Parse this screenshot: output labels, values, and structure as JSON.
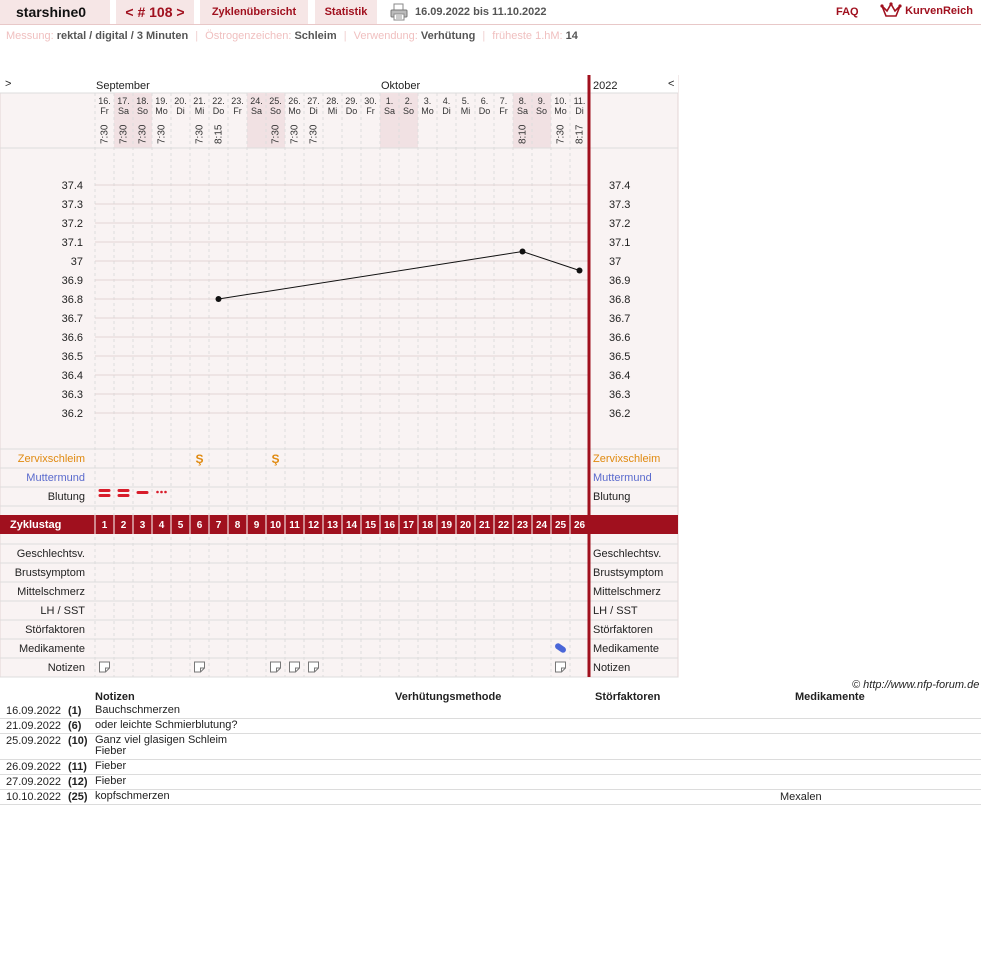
{
  "header": {
    "username": "starshine0",
    "cycle": "< # 108 >",
    "overview_label": "Zyklenübersicht",
    "statistics_label": "Statistik",
    "date_range": "16.09.2022 bis 11.10.2022",
    "faq_label": "FAQ",
    "logo_text": "KurvenReich"
  },
  "info": {
    "messung_label": "Messung:",
    "messung_value": "rektal / digital / 3 Minuten",
    "oestrogen_label": "Östrogenzeichen:",
    "oestrogen_value": "Schleim",
    "verwendung_label": "Verwendung:",
    "verwendung_value": "Verhütung",
    "hm_label": "früheste 1.hM:",
    "hm_value": "14"
  },
  "chart_data": {
    "type": "line",
    "title": "",
    "xlabel": "",
    "ylabel": "",
    "ylim": [
      36.2,
      37.4
    ],
    "y_ticks": [
      "37.4",
      "37.3",
      "37.2",
      "37.1",
      "37",
      "36.9",
      "36.8",
      "36.7",
      "36.6",
      "36.5",
      "36.4",
      "36.3",
      "36.2"
    ],
    "months": [
      {
        "label": "September",
        "start_index": 0
      },
      {
        "label": "Oktober",
        "start_index": 15
      }
    ],
    "year": "2022",
    "nav_prev": ">",
    "nav_next": "<",
    "dates": [
      "16.",
      "17.",
      "18.",
      "19.",
      "20.",
      "21.",
      "22.",
      "23.",
      "24.",
      "25.",
      "26.",
      "27.",
      "28.",
      "29.",
      "30.",
      "1.",
      "2.",
      "3.",
      "4.",
      "5.",
      "6.",
      "7.",
      "8.",
      "9.",
      "10.",
      "11."
    ],
    "weekdays": [
      "Fr",
      "Sa",
      "So",
      "Mo",
      "Di",
      "Mi",
      "Do",
      "Fr",
      "Sa",
      "So",
      "Mo",
      "Di",
      "Mi",
      "Do",
      "Fr",
      "Sa",
      "So",
      "Mo",
      "Di",
      "Mi",
      "Do",
      "Fr",
      "Sa",
      "So",
      "Mo",
      "Di"
    ],
    "weekend": [
      false,
      true,
      true,
      false,
      false,
      false,
      false,
      false,
      true,
      true,
      false,
      false,
      false,
      false,
      false,
      true,
      true,
      false,
      false,
      false,
      false,
      false,
      true,
      true,
      false,
      false
    ],
    "times": [
      "7:30",
      "7:30",
      "7:30",
      "7:30",
      "",
      "7:30",
      "8:15",
      "",
      "",
      "7:30",
      "7:30",
      "7:30",
      "",
      "",
      "",
      "",
      "",
      "",
      "",
      "",
      "",
      "",
      "8:10",
      "",
      "7:30",
      "8:17"
    ],
    "cycle_days": [
      "1",
      "2",
      "3",
      "4",
      "5",
      "6",
      "7",
      "8",
      "9",
      "10",
      "11",
      "12",
      "13",
      "14",
      "15",
      "16",
      "17",
      "18",
      "19",
      "20",
      "21",
      "22",
      "23",
      "24",
      "25",
      "26"
    ],
    "series": [
      {
        "points": [
          {
            "day": 7,
            "temp": 36.8
          },
          {
            "day": 23,
            "temp": 37.05
          },
          {
            "day": 26,
            "temp": 36.95
          }
        ]
      }
    ],
    "rows_above": [
      "Zervixschleim",
      "Muttermund",
      "Blutung"
    ],
    "cycle_label": "Zyklustag",
    "rows_below": [
      "Geschlechtsv.",
      "Brustsymptom",
      "Mittelschmerz",
      "LH / SST",
      "Störfaktoren",
      "Medikamente",
      "Notizen"
    ],
    "schleim_days": [
      6,
      10
    ],
    "schleim_symbol": "Ş",
    "bleeding": [
      {
        "day": 1,
        "level": "strong"
      },
      {
        "day": 2,
        "level": "strong"
      },
      {
        "day": 3,
        "level": "medium"
      },
      {
        "day": 4,
        "level": "spotting"
      }
    ],
    "medication_days": [
      25
    ],
    "note_days": [
      1,
      6,
      10,
      11,
      12,
      25
    ]
  },
  "colors": {
    "accent": "#a0101e",
    "schleim": "#e08a10",
    "muttermund": "#5a6acd",
    "bleeding": "#d81c2a",
    "medication": "#4a66d8",
    "weekend": "#f1e1e3",
    "grid_bg": "#f9f3f3"
  },
  "copyright": "© http://www.nfp-forum.de",
  "notes_table": {
    "headers": {
      "notes": "Notizen",
      "method": "Verhütungsmethode",
      "disturbances": "Störfaktoren",
      "medication": "Medikamente"
    },
    "rows": [
      {
        "date": "16.09.2022",
        "cycle_day": "(1)",
        "note": "Bauchschmerzen",
        "medication": ""
      },
      {
        "date": "21.09.2022",
        "cycle_day": "(6)",
        "note": "oder leichte Schmierblutung?",
        "medication": ""
      },
      {
        "date": "25.09.2022",
        "cycle_day": "(10)",
        "note": "Ganz viel glasigen Schleim\nFieber",
        "medication": ""
      },
      {
        "date": "26.09.2022",
        "cycle_day": "(11)",
        "note": "Fieber",
        "medication": ""
      },
      {
        "date": "27.09.2022",
        "cycle_day": "(12)",
        "note": "Fieber",
        "medication": ""
      },
      {
        "date": "10.10.2022",
        "cycle_day": "(25)",
        "note": "kopfschmerzen",
        "medication": "Mexalen"
      }
    ]
  }
}
